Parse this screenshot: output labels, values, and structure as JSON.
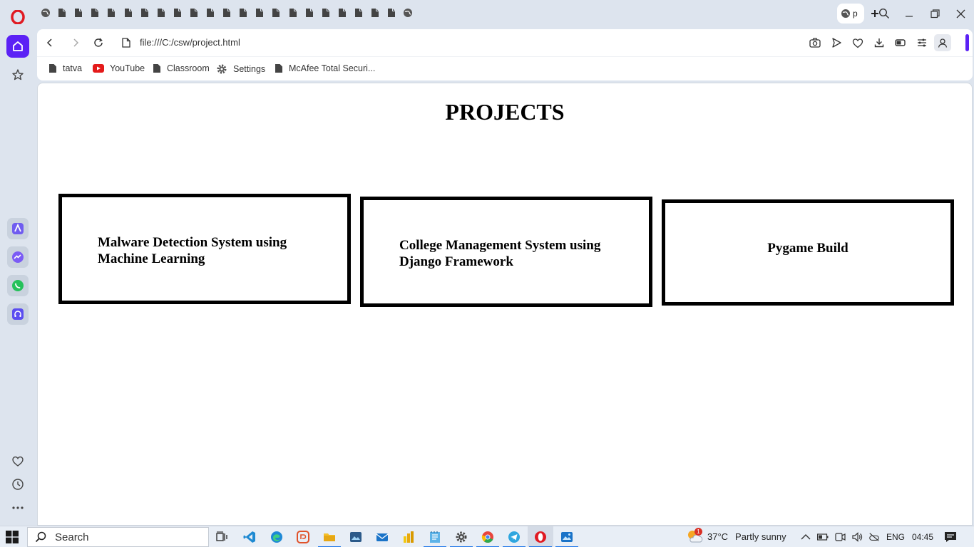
{
  "browser": {
    "active_tab_label": "p",
    "url": "file:///C:/csw/project.html",
    "accent_color": "#5b21f5"
  },
  "bookmarks": [
    {
      "label": "tatva",
      "icon": "document-icon"
    },
    {
      "label": "YouTube",
      "icon": "youtube-icon"
    },
    {
      "label": "Classroom",
      "icon": "document-icon"
    },
    {
      "label": "Settings",
      "icon": "gear-icon"
    },
    {
      "label": "McAfee Total Securi...",
      "icon": "document-icon"
    }
  ],
  "page": {
    "title": "PROJECTS",
    "projects": [
      {
        "label": "Malware Detection System using Machine Learning"
      },
      {
        "label": "College Management System using Django Framework"
      },
      {
        "label": "Pygame Build"
      }
    ]
  },
  "taskbar": {
    "search_label": "Search",
    "weather_temp": "37°C",
    "weather_desc": "Partly sunny",
    "weather_badge": "1",
    "language": "ENG",
    "time": "04:45"
  }
}
